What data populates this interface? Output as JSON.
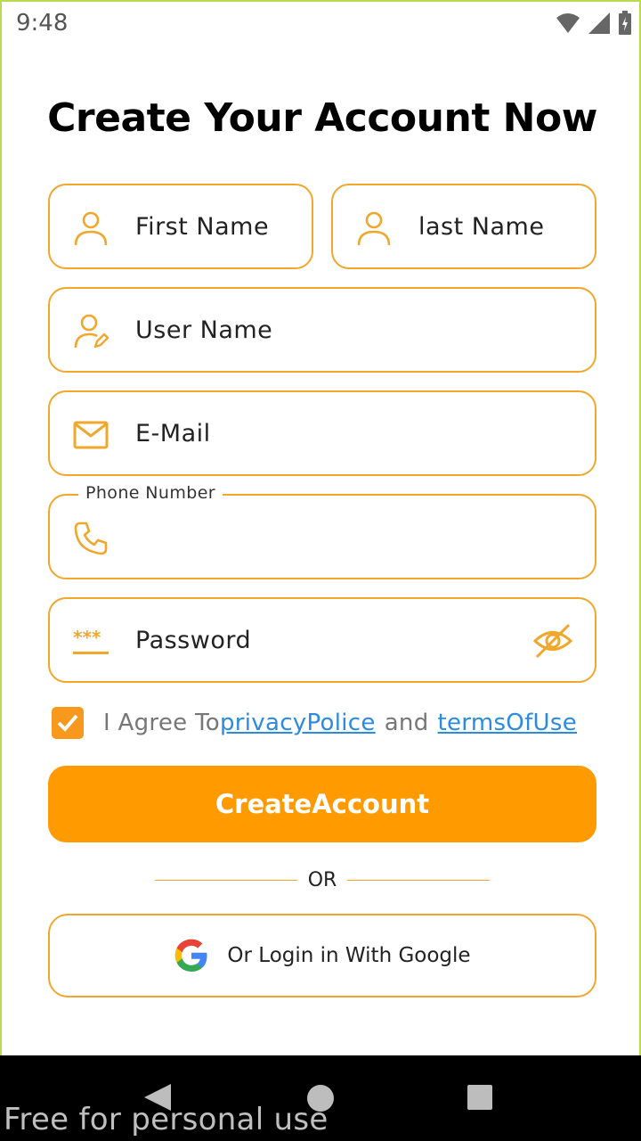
{
  "status_bar": {
    "time": "9:48",
    "icons": [
      "wifi-icon",
      "signal-icon",
      "battery-icon"
    ]
  },
  "title": "Create Your Account Now",
  "fields": {
    "first_name": {
      "label": "First Name",
      "icon": "person-icon"
    },
    "last_name": {
      "label": "last Name",
      "icon": "person-icon"
    },
    "user_name": {
      "label": "User Name",
      "icon": "person-edit-icon"
    },
    "email": {
      "label": "E-Mail",
      "icon": "mail-icon"
    },
    "phone": {
      "label": "Phone Number",
      "icon": "phone-icon"
    },
    "password": {
      "label": "Password",
      "icon": "password-dots-icon",
      "toggle_icon": "eye-off-icon"
    }
  },
  "agreement": {
    "checked": true,
    "prefix": "I Agree To",
    "privacy_link": " privacyPolice ",
    "connector": "and",
    "terms_link": " termsOfUse"
  },
  "create_button": {
    "label": "CreateAccount"
  },
  "divider": {
    "label": "OR"
  },
  "google_button": {
    "label": "Or Login in With Google",
    "icon": "google-icon"
  },
  "watermark": "Free for personal use",
  "colors": {
    "accent": "#ff9a00",
    "border": "#f0a72c",
    "link": "#2a8be0",
    "frame": "#b9dc4e"
  }
}
